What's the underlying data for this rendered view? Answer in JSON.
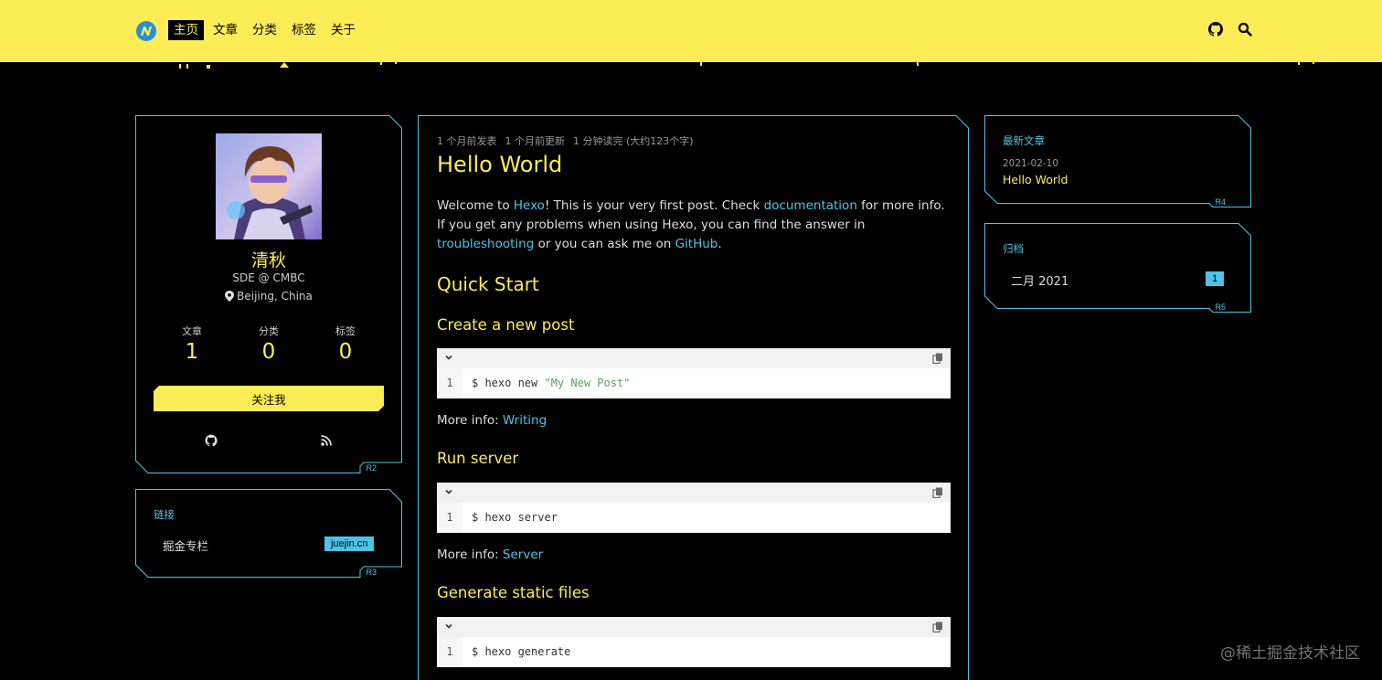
{
  "nav": {
    "items": [
      {
        "label": "主页",
        "active": true
      },
      {
        "label": "文章",
        "active": false
      },
      {
        "label": "分类",
        "active": false
      },
      {
        "label": "标签",
        "active": false
      },
      {
        "label": "关于",
        "active": false
      }
    ],
    "icons": [
      "github-icon",
      "search-icon"
    ]
  },
  "colors": {
    "accent": "#fced57",
    "cyan": "#4fc3e6",
    "background": "#000000"
  },
  "profile": {
    "name": "清秋",
    "title": "SDE @ CMBC",
    "location": "Beijing, China",
    "stats": [
      {
        "label": "文章",
        "value": "1"
      },
      {
        "label": "分类",
        "value": "0"
      },
      {
        "label": "标签",
        "value": "0"
      }
    ],
    "follow_label": "关注我",
    "card_tag": "R2"
  },
  "links_widget": {
    "title": "链接",
    "item_label": "掘金专栏",
    "item_badge": "juejin.cn",
    "card_tag": "R3"
  },
  "post": {
    "meta": [
      "1 个月前发表",
      "1 个月前更新",
      "1 分钟读完 (大约123个字)"
    ],
    "title": "Hello World",
    "intro": {
      "t1": "Welcome to ",
      "hexo_link": "Hexo",
      "t2": "! This is your very first post. Check ",
      "doc_link": "documentation",
      "t3": " for more info. If you get any problems when using Hexo, you can find the answer in ",
      "trouble_link": "troubleshooting",
      "t4": " or you can ask me on ",
      "github_link": "GitHub",
      "t5": "."
    },
    "quick_start": "Quick Start",
    "sections": [
      {
        "heading": "Create a new post",
        "line_no": "1",
        "cmd": "$ hexo new ",
        "arg": "\"My New Post\"",
        "more_label": "More info: ",
        "more_link": "Writing"
      },
      {
        "heading": "Run server",
        "line_no": "1",
        "cmd": "$ hexo server",
        "arg": "",
        "more_label": "More info: ",
        "more_link": "Server"
      },
      {
        "heading": "Generate static files",
        "line_no": "1",
        "cmd": "$ hexo generate",
        "arg": "",
        "more_label": "",
        "more_link": ""
      }
    ]
  },
  "recent": {
    "title": "最新文章",
    "date": "2021-02-10",
    "post_title": "Hello World",
    "card_tag": "R4"
  },
  "archive": {
    "title": "归档",
    "label": "二月 2021",
    "count": "1",
    "card_tag": "R5"
  },
  "watermark": "@稀土掘金技术社区"
}
